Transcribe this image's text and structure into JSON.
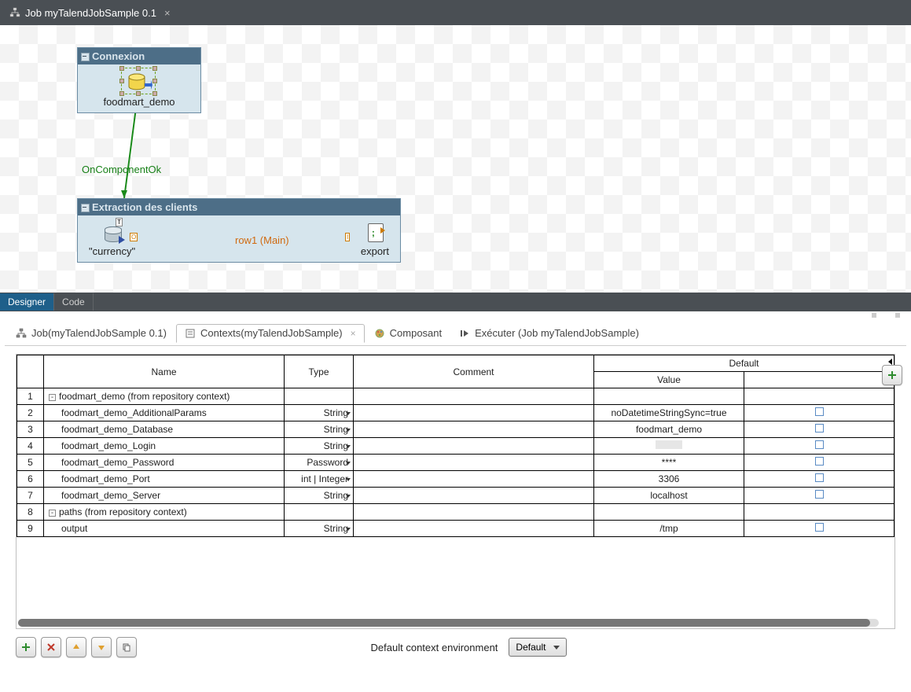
{
  "editor_tab": {
    "title": "Job myTalendJobSample 0.1"
  },
  "canvas": {
    "subjob1": {
      "title": "Connexion",
      "component_label": "foodmart_demo"
    },
    "connector1": "OnComponentOk",
    "subjob2": {
      "title": "Extraction des clients",
      "left_label": "\"currency\"",
      "flow_label": "row1 (Main)",
      "right_label": "export"
    }
  },
  "designer_tabs": {
    "designer": "Designer",
    "code": "Code"
  },
  "view_tabs": {
    "job": "Job(myTalendJobSample 0.1)",
    "contexts": "Contexts(myTalendJobSample)",
    "component": "Composant",
    "run": "Exécuter (Job myTalendJobSample)"
  },
  "table": {
    "headers": {
      "name": "Name",
      "type": "Type",
      "comment": "Comment",
      "default": "Default",
      "value": "Value"
    },
    "rows": [
      {
        "n": "1",
        "name": "foodmart_demo (from repository context)",
        "group": true
      },
      {
        "n": "2",
        "name": "foodmart_demo_AdditionalParams",
        "type": "String",
        "value": "noDatetimeStringSync=true"
      },
      {
        "n": "3",
        "name": "foodmart_demo_Database",
        "type": "String",
        "value": "foodmart_demo"
      },
      {
        "n": "4",
        "name": "foodmart_demo_Login",
        "type": "String",
        "hidden": true
      },
      {
        "n": "5",
        "name": "foodmart_demo_Password",
        "type": "Password",
        "value": "****"
      },
      {
        "n": "6",
        "name": "foodmart_demo_Port",
        "type": "int | Integer",
        "value": "3306"
      },
      {
        "n": "7",
        "name": "foodmart_demo_Server",
        "type": "String",
        "value": "localhost"
      },
      {
        "n": "8",
        "name": "paths (from repository context)",
        "group": true
      },
      {
        "n": "9",
        "name": "output",
        "type": "String",
        "value": "/tmp"
      }
    ]
  },
  "bottom": {
    "env_label": "Default context environment",
    "env_value": "Default"
  }
}
